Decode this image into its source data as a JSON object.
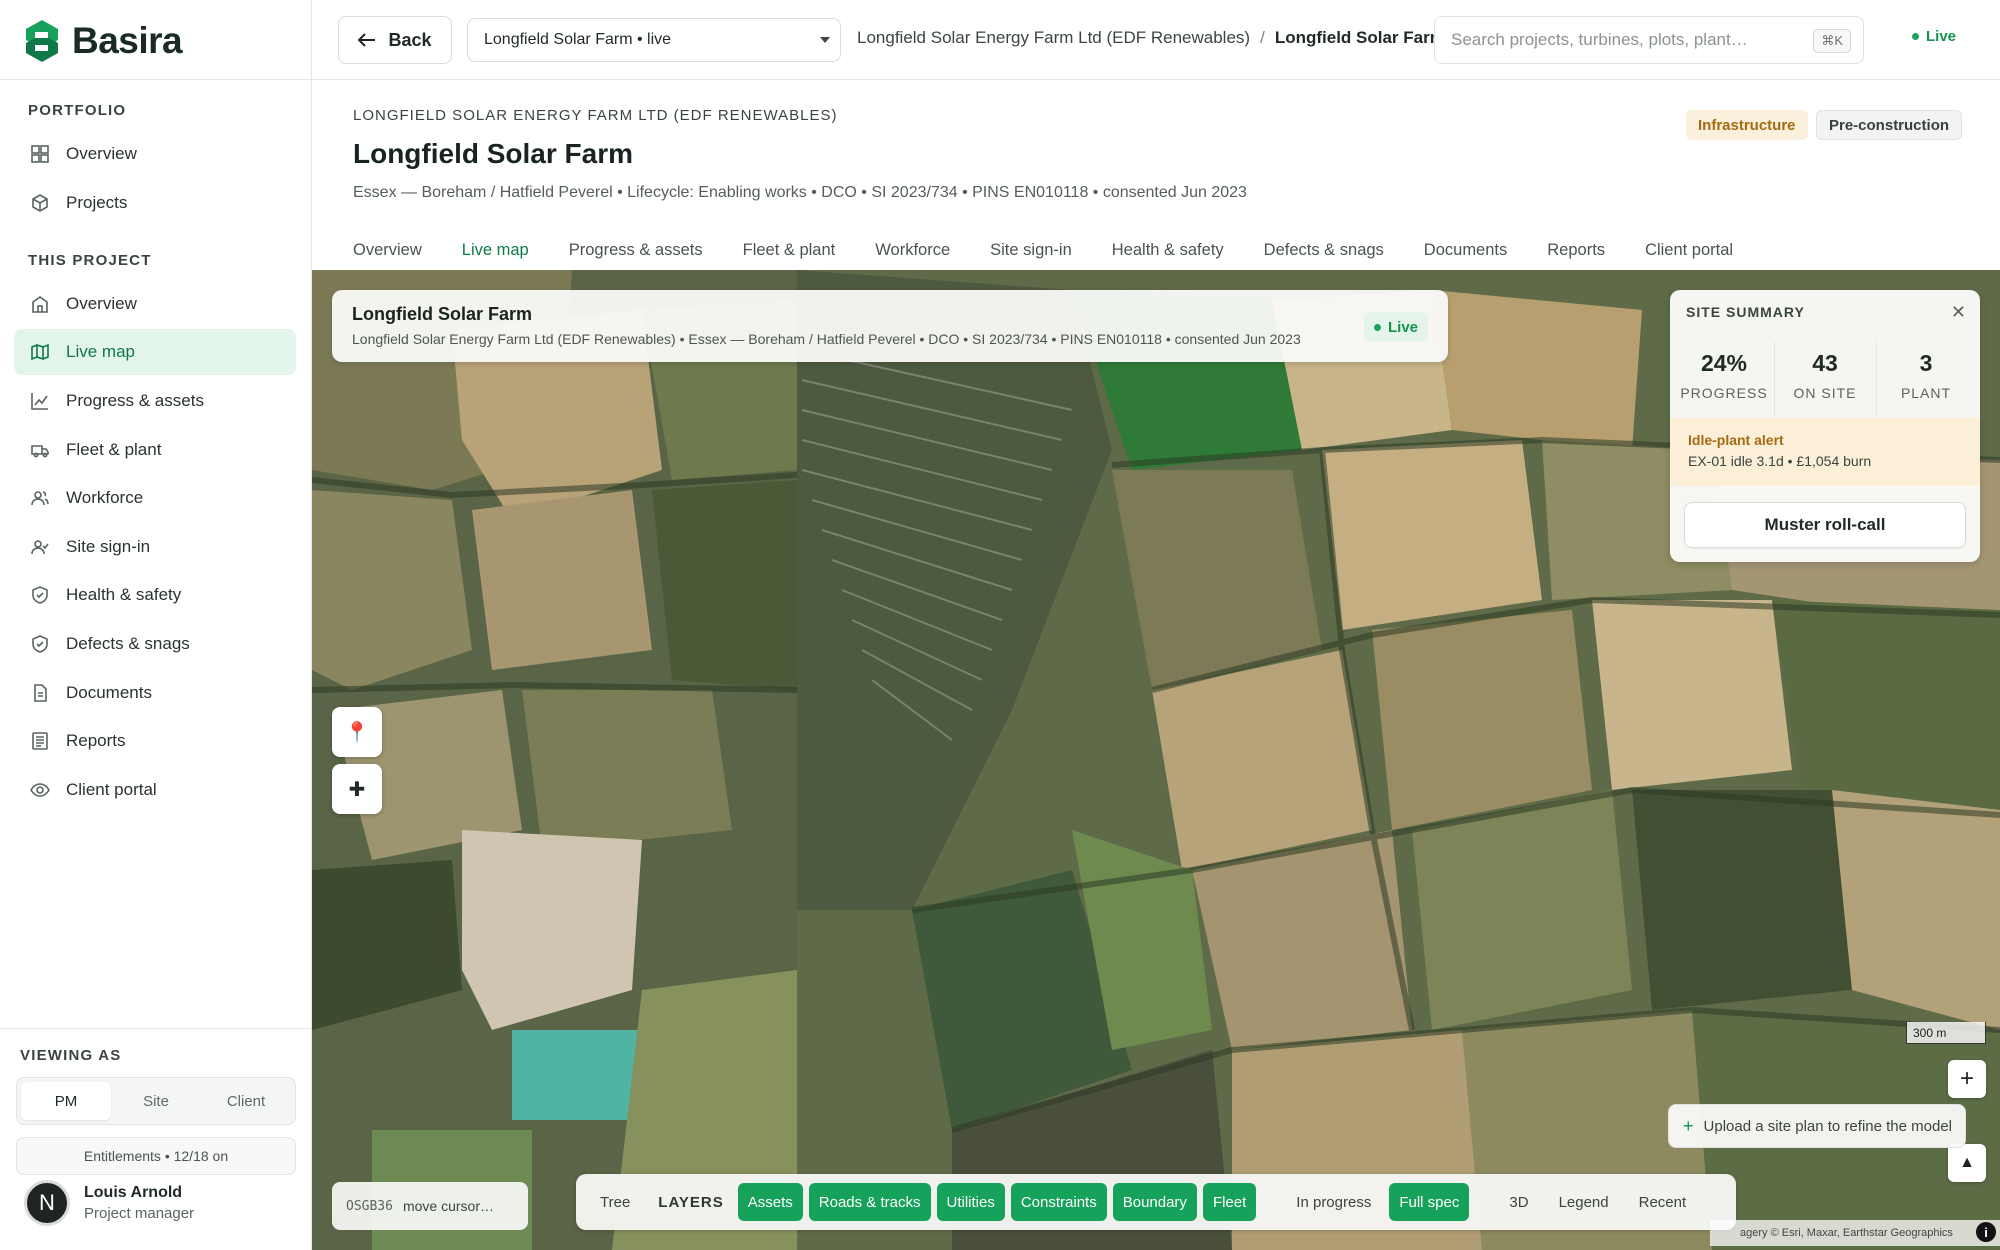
{
  "app": {
    "name": "Basira"
  },
  "sidebar": {
    "portfolio_label": "PORTFOLIO",
    "portfolio_items": [
      {
        "label": "Overview",
        "icon": "grid-icon"
      },
      {
        "label": "Projects",
        "icon": "cube-icon"
      }
    ],
    "project_label": "THIS PROJECT",
    "project_items": [
      {
        "label": "Overview",
        "icon": "building-icon"
      },
      {
        "label": "Live map",
        "icon": "map-icon",
        "active": true
      },
      {
        "label": "Progress & assets",
        "icon": "chart-icon"
      },
      {
        "label": "Fleet & plant",
        "icon": "truck-icon"
      },
      {
        "label": "Workforce",
        "icon": "users-icon"
      },
      {
        "label": "Site sign-in",
        "icon": "user-check-icon"
      },
      {
        "label": "Health & safety",
        "icon": "shield-icon"
      },
      {
        "label": "Defects & snags",
        "icon": "shield-check-icon"
      },
      {
        "label": "Documents",
        "icon": "file-icon"
      },
      {
        "label": "Reports",
        "icon": "report-icon"
      },
      {
        "label": "Client portal",
        "icon": "eye-icon"
      }
    ],
    "viewing_as_label": "VIEWING AS",
    "roles": [
      "PM",
      "Site",
      "Client"
    ],
    "active_role": "PM",
    "entitlements": "Entitlements • 12/18 on",
    "user": {
      "initial": "N",
      "name": "Louis Arnold",
      "role": "Project manager"
    }
  },
  "topbar": {
    "back_label": "Back",
    "project_select": "Longfield Solar Farm • live",
    "breadcrumb": [
      "Longfield Solar Energy Farm Ltd (EDF Renewables)",
      "Longfield Solar Farm"
    ],
    "breadcrumb_sep": "/",
    "search_placeholder": "Search projects, turbines, plots, plant…",
    "search_shortcut": "⌘K",
    "status": "Live"
  },
  "header": {
    "org": "LONGFIELD SOLAR ENERGY FARM LTD (EDF RENEWABLES)",
    "title": "Longfield Solar Farm",
    "meta": "Essex — Boreham / Hatfield Peverel • Lifecycle: Enabling works • DCO • SI 2023/734 • PINS EN010118 • consented Jun 2023",
    "tags": [
      "Infrastructure",
      "Pre-construction"
    ],
    "tabs": [
      "Overview",
      "Live map",
      "Progress & assets",
      "Fleet & plant",
      "Workforce",
      "Site sign-in",
      "Health & safety",
      "Defects & snags",
      "Documents",
      "Reports",
      "Client portal"
    ],
    "active_tab": "Live map"
  },
  "map": {
    "card": {
      "title": "Longfield Solar Farm",
      "subtitle": "Longfield Solar Energy Farm Ltd (EDF Renewables) • Essex — Boreham / Hatfield Peverel • DCO • SI 2023/734 • PINS EN010118 • consented Jun 2023",
      "status": "Live"
    },
    "summary": {
      "heading": "SITE SUMMARY",
      "stats": [
        {
          "value": "24%",
          "label": "PROGRESS"
        },
        {
          "value": "43",
          "label": "ON SITE"
        },
        {
          "value": "3",
          "label": "PLANT"
        }
      ],
      "alert_title": "Idle-plant alert",
      "alert_text": "EX-01 idle 3.1d • £1,054 burn",
      "action": "Muster roll-call"
    },
    "tools": [
      {
        "icon": "pin-icon",
        "glyph": "📍"
      },
      {
        "icon": "crosshair-icon",
        "glyph": "✚"
      }
    ],
    "zoom_in": "+",
    "zoom_out": "−",
    "compass": "▲",
    "scale": "300 m",
    "upload_hint": "Upload a site plan to refine the model",
    "coords": {
      "crs": "OSGB36",
      "text": "move cursor…"
    },
    "layer_bar": {
      "tree": "Tree",
      "layers_label": "LAYERS",
      "layers": [
        "Assets",
        "Roads & tracks",
        "Utilities",
        "Constraints",
        "Boundary",
        "Fleet"
      ],
      "in_progress": "In progress",
      "full_spec": "Full spec",
      "view_3d": "3D",
      "legend": "Legend",
      "recent": "Recent"
    },
    "attribution": "agery © Esri, Maxar, Earthstar Geographics",
    "colors": {
      "accent": "#17a25b",
      "alert_bg": "#fbefd8",
      "alert_text": "#a46a12"
    }
  }
}
